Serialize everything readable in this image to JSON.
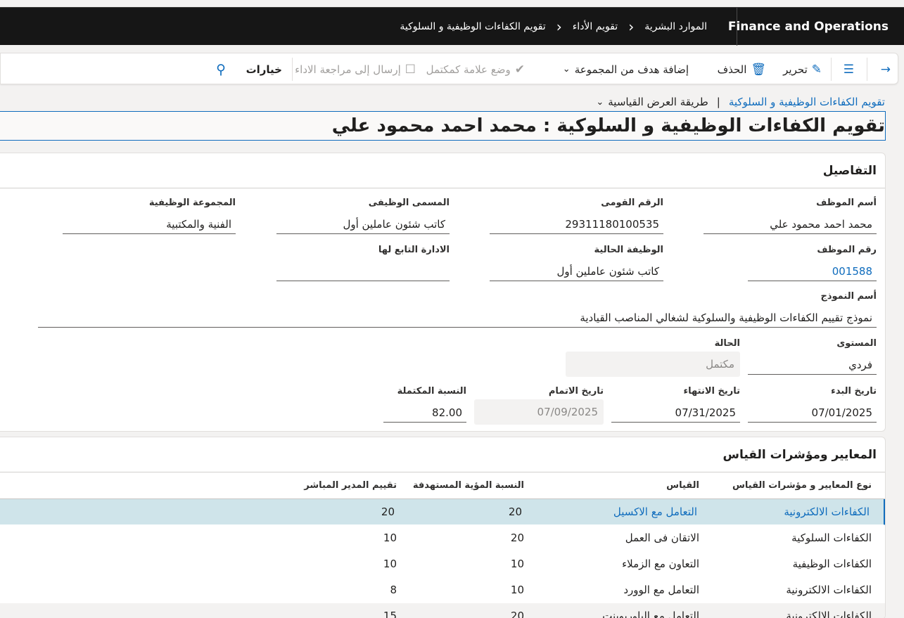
{
  "nav": {
    "brand": "Finance and Operations",
    "breadcrumb": [
      "الموارد البشرية",
      "تقويم الأداء",
      "تقويم الكفاءات الوظيفية و السلوكية"
    ]
  },
  "actions": {
    "edit": "تحرير",
    "delete": "الحذف",
    "add_goal": "إضافة هدف من المجموعة",
    "mark_complete": "وضع علامة كمكتمل",
    "send_review": "إرسال إلى مراجعة الاداء",
    "options": "خيارات"
  },
  "header": {
    "form_link": "تقويم الكفاءات الوظيفية و السلوكية",
    "separator": "|",
    "view": "طريقة العرض القياسية",
    "title": "تقويم الكفاءات الوظيفية و السلوكية : محمد احمد محمود علي"
  },
  "details": {
    "section_title": "التفاصيل",
    "employee_name_label": "أسم الموظف",
    "employee_name": "محمد احمد محمود علي",
    "national_id_label": "الرقم القومى",
    "national_id": "29311180100535",
    "job_title_label": "المسمى الوظيفى",
    "job_title": "كاتب شئون عاملين أول",
    "job_group_label": "المجموعة الوظيفية",
    "job_group": "الفنية والمكتبية",
    "employee_no_label": "رقم الموظف",
    "employee_no": "001588",
    "current_job_label": "الوظيفة الحالية",
    "current_job": "كاتب شئون عاملين أول",
    "department_label": "الادارة التابع لها",
    "department": "",
    "template_label": "أسم النموذج",
    "template": "نموذج تقييم الكفاءات الوظيفية والسلوكية لشغالي المناصب القيادية",
    "level_label": "المستوى",
    "level": "فردي",
    "status_label": "الحالة",
    "status": "مكتمل",
    "start_date_label": "تاريخ البدء",
    "start_date": "07/01/2025",
    "end_date_label": "تاريخ الانتهاء",
    "end_date": "07/31/2025",
    "completion_date_label": "تاريخ الاتمام",
    "completion_date": "07/09/2025",
    "completion_pct_label": "النسبة المكتملة",
    "completion_pct": "82.00"
  },
  "criteria": {
    "section_title": "المعايير ومؤشرات القياس",
    "columns": {
      "type": "نوع المعايير و مؤشرات القياس",
      "measure": "القياس",
      "target": "النسبة المؤية المستهدفة",
      "manager": "تقييم المدير المباشر"
    },
    "rows": [
      {
        "type": "الكفاءات الالكترونية",
        "measure": "التعامل مع الاكسيل",
        "target": "20",
        "manager": "20"
      },
      {
        "type": "الكفاءات السلوكية",
        "measure": "الاتقان فى العمل",
        "target": "20",
        "manager": "10"
      },
      {
        "type": "الكفاءات الوظيفية",
        "measure": "التعاون مع الزملاء",
        "target": "10",
        "manager": "10"
      },
      {
        "type": "الكفاءات الالكترونية",
        "measure": "التعامل مع الوورد",
        "target": "10",
        "manager": "8"
      },
      {
        "type": "الكفاءات الالكترونية",
        "measure": "التعامل مع الباوربوينت",
        "target": "20",
        "manager": "15"
      }
    ]
  },
  "colors": {
    "accent": "#0f6cbd",
    "topbar": "#161616",
    "selected_row": "#cfe4ea"
  }
}
